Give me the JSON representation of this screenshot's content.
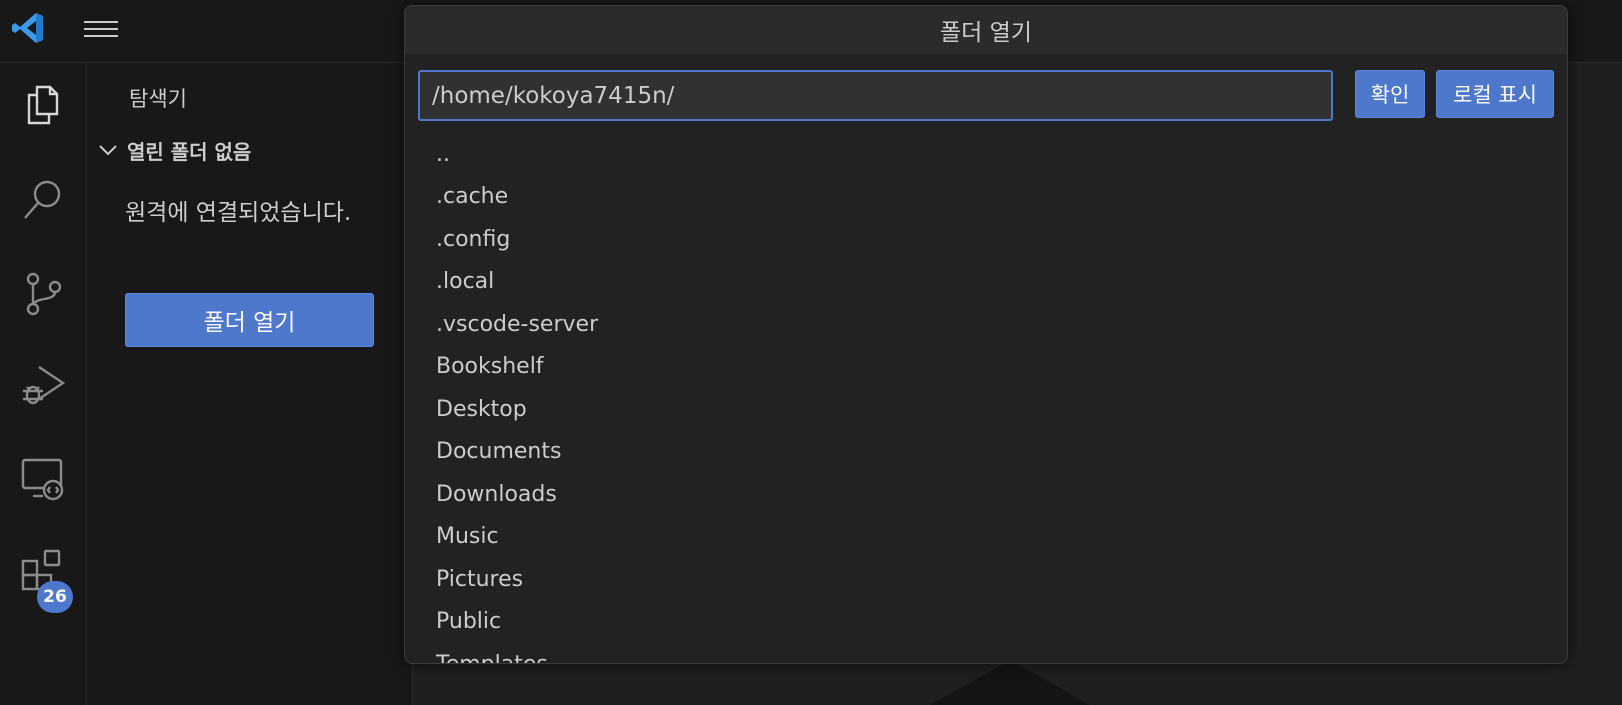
{
  "titlebar": {
    "logo_icon": "vscode-logo-icon",
    "menu_icon": "hamburger-menu-icon"
  },
  "activity_bar": {
    "items": [
      {
        "name": "explorer",
        "icon": "files-icon"
      },
      {
        "name": "search",
        "icon": "search-icon"
      },
      {
        "name": "source-control",
        "icon": "source-control-icon"
      },
      {
        "name": "run-debug",
        "icon": "run-debug-icon"
      },
      {
        "name": "remote-explorer",
        "icon": "remote-explorer-icon"
      },
      {
        "name": "extensions",
        "icon": "extensions-icon",
        "badge": "26"
      }
    ]
  },
  "sidebar": {
    "title": "탐색기",
    "section_label": "열린 폴더 없음",
    "message": "원격에 연결되었습니다.",
    "open_folder_button": "폴더 열기"
  },
  "dialog": {
    "title": "폴더 열기",
    "path_value": "/home/kokoya7415n/",
    "ok_button": "확인",
    "show_local_button": "로컬 표시",
    "items": [
      "..",
      ".cache",
      ".config",
      ".local",
      ".vscode-server",
      "Bookshelf",
      "Desktop",
      "Documents",
      "Downloads",
      "Music",
      "Pictures",
      "Public",
      "Templates"
    ]
  },
  "colors": {
    "accent": "#4d78cc",
    "background": "#1f1f1f",
    "sidebar": "#181818",
    "dialog": "#222222"
  }
}
